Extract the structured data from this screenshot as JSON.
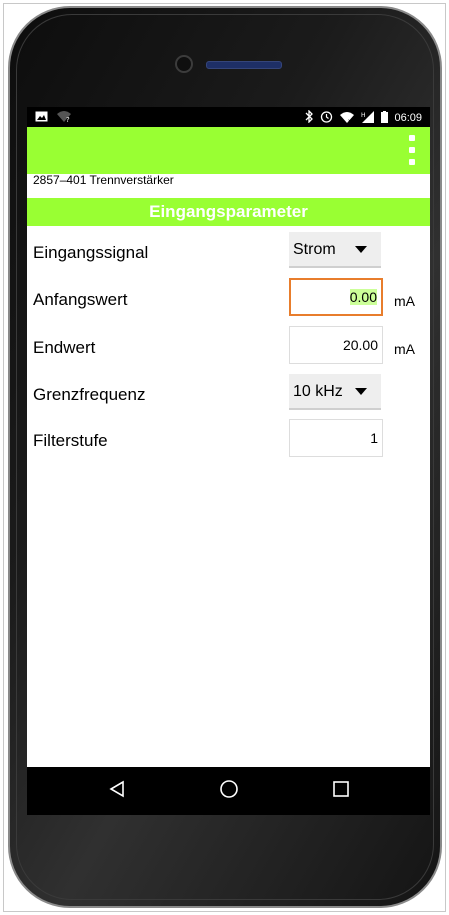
{
  "status_bar": {
    "time": "06:09",
    "left_icons": [
      "image-icon",
      "wifi-unknown-icon"
    ],
    "right_icons": [
      "bluetooth-icon",
      "alarm-icon",
      "wifi-x-icon",
      "signal-h-icon",
      "battery-icon"
    ]
  },
  "app_bar": {
    "background_color": "#99ff33",
    "menu_icon": "overflow-menu-icon"
  },
  "device_name": "2857–401 Trennverstärker",
  "section": {
    "title": "Eingangsparameter",
    "background_color": "#99ff33"
  },
  "params": {
    "eingangssignal": {
      "label": "Eingangssignal",
      "value": "Strom"
    },
    "anfangswert": {
      "label": "Anfangswert",
      "value": "0.00",
      "unit": "mA"
    },
    "endwert": {
      "label": "Endwert",
      "value": "20.00",
      "unit": "mA"
    },
    "grenzfrequenz": {
      "label": "Grenzfrequenz",
      "value": "10 kHz"
    },
    "filterstufe": {
      "label": "Filterstufe",
      "value": "1"
    }
  },
  "nav_bar": {
    "icons": [
      "back-icon",
      "home-icon",
      "recent-apps-icon"
    ]
  },
  "colors": {
    "accent": "#99ff33",
    "focus_border": "#e87d2c",
    "selection_highlight": "#ccff99"
  }
}
